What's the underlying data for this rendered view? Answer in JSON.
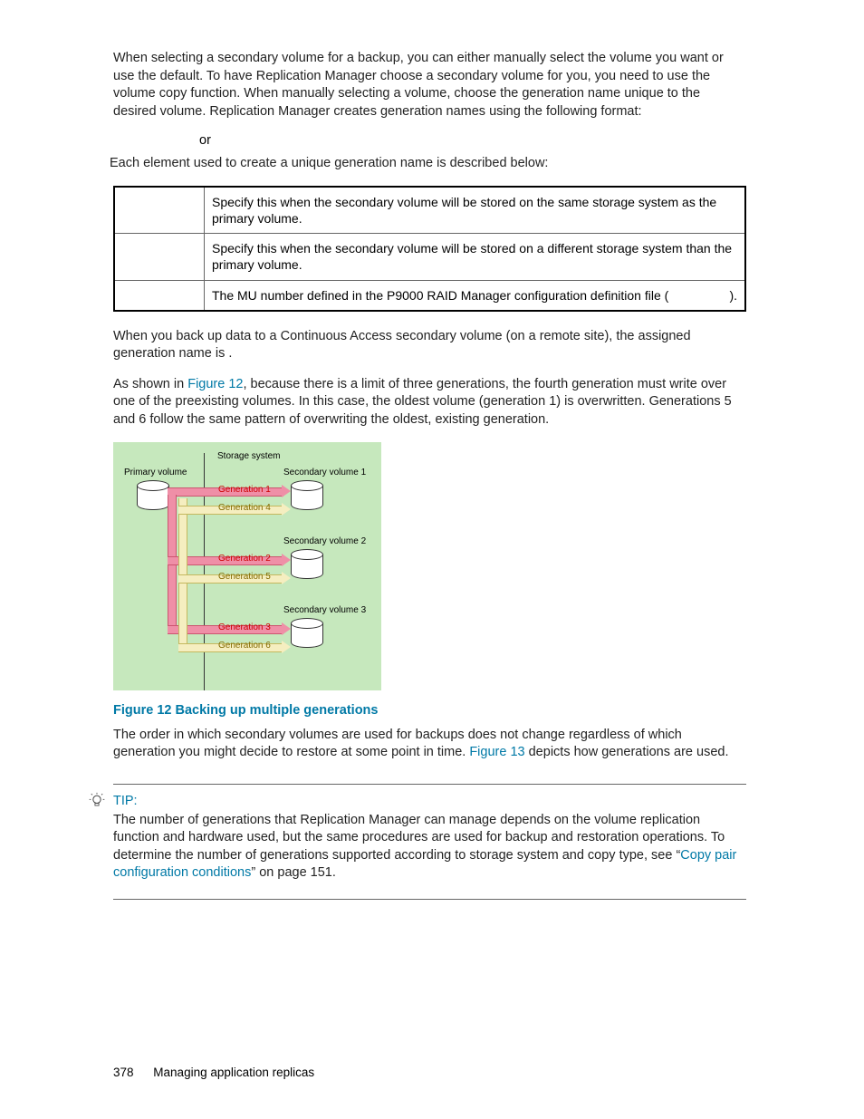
{
  "para1": "When selecting a secondary volume for a backup, you can either manually select the volume you want or use the default. To have Replication Manager choose a secondary volume for you, you need to use the volume copy function. When manually selecting a volume, choose the generation name unique to the desired volume. Replication Manager creates generation names using the following format:",
  "or_text": "or",
  "para2": "Each element used to create a unique generation name is described below:",
  "table": {
    "rows": [
      {
        "col1": "",
        "col2": "Specify this when the secondary volume will be stored on the same storage system as the primary volume."
      },
      {
        "col1": "",
        "col2": "Specify this when the secondary volume will be stored on a different storage system than the primary volume."
      },
      {
        "col1": "",
        "col2_a": "The MU number defined in the P9000 RAID Manager configuration definition file (",
        "col2_b": ")."
      }
    ]
  },
  "para3_a": "When you back up data to a Continuous Access secondary volume (on a remote site), the assigned generation name is ",
  "para3_b": ".",
  "para4_a": "As shown in ",
  "para4_link": "Figure 12",
  "para4_b": ", because there is a limit of three generations, the fourth generation must write over one of the preexisting volumes. In this case, the oldest volume (generation 1) is overwritten. Generations 5 and 6 follow the same pattern of overwriting the oldest, existing generation.",
  "diagram": {
    "storage_system": "Storage system",
    "primary_volume": "Primary volume",
    "sv1": "Secondary volume 1",
    "sv2": "Secondary volume 2",
    "sv3": "Secondary volume 3",
    "gen1": "Generation 1",
    "gen2": "Generation 2",
    "gen3": "Generation 3",
    "gen4": "Generation 4",
    "gen5": "Generation 5",
    "gen6": "Generation 6"
  },
  "figure_caption": "Figure 12 Backing up multiple generations",
  "para5_a": "The order in which secondary volumes are used for backups does not change regardless of which generation you might decide to restore at some point in time. ",
  "para5_link": "Figure 13",
  "para5_b": " depicts how generations are used.",
  "tip": {
    "label": "TIP:",
    "body_a": "The number of generations that Replication Manager can manage depends on the volume replication function and hardware used, but the same procedures are used for backup and restoration operations. To determine the number of generations supported according to storage system and copy type, see “",
    "body_link": "Copy pair configuration conditions",
    "body_b": "” on page 151."
  },
  "footer": {
    "page": "378",
    "section": "Managing application replicas"
  }
}
